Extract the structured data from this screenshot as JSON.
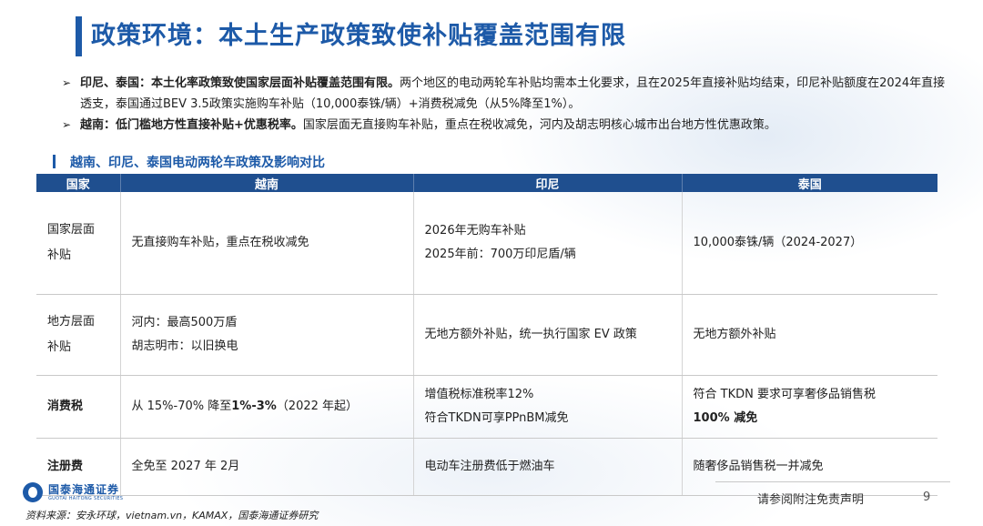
{
  "header": {
    "title": "政策环境：本土生产政策致使补贴覆盖范围有限"
  },
  "bullets": [
    {
      "arrow": "➢",
      "lead": "印尼、泰国：本土化率政策致使国家层面补贴覆盖范围有限。",
      "text": "两个地区的电动两轮车补贴均需本土化要求，且在2025年直接补贴均结束，印尼补贴额度在2024年直接透支，泰国通过BEV 3.5政策实施购车补贴（10,000泰铢/辆）+消费税减免（从5%降至1%）。"
    },
    {
      "arrow": "➢",
      "lead": "越南：低门槛地方性直接补贴+优惠税率。",
      "text": "国家层面无直接购车补贴，重点在税收减免，河内及胡志明核心城市出台地方性优惠政策。"
    }
  ],
  "section": {
    "mark": "l",
    "title": "越南、印尼、泰国电动两轮车政策及影响对比"
  },
  "table": {
    "headers": [
      "国家",
      "越南",
      "印尼",
      "泰国"
    ],
    "rows": [
      {
        "label": [
          "国家层面",
          "补贴"
        ],
        "vietnam": [
          "无直接购车补贴，重点在税收减免"
        ],
        "indonesia": [
          "2026年无购车补贴",
          "2025年前：700万印尼盾/辆"
        ],
        "thailand": [
          "10,000泰铢/辆（2024-2027）"
        ]
      },
      {
        "label": [
          "地方层面",
          "补贴"
        ],
        "vietnam": [
          "河内：最高500万盾",
          "胡志明市：以旧换电"
        ],
        "indonesia": [
          "无地方额外补贴，统一执行国家 EV 政策"
        ],
        "thailand": [
          "无地方额外补贴"
        ]
      },
      {
        "label": [
          "消费税"
        ],
        "vietnam_pre": "从 15%-70% 降至",
        "vietnam_bold": "1%-3%",
        "vietnam_post": "（2022 年起）",
        "indonesia": [
          "增值税标准税率12%",
          "符合TKDN可享PPnBM减免"
        ],
        "thailand": [
          "符合 TKDN 要求可享奢侈品销售税",
          "100% 减免"
        ]
      },
      {
        "label": [
          "注册费"
        ],
        "vietnam": [
          "全免至 2027 年 2月"
        ],
        "indonesia": [
          "电动车注册费低于燃油车"
        ],
        "thailand": [
          "随奢侈品销售税一并减免"
        ]
      }
    ]
  },
  "footer": {
    "logo_cn": "国泰海通证券",
    "logo_en": "GUOTAI HAITONG SECURITIES",
    "disclaimer": "请参阅附注免责声明",
    "page_number": "9",
    "source": "资料来源：安永环球，vietnam.vn，KAMAX，国泰海通证券研究"
  },
  "colors": {
    "brand": "#1d5aa8",
    "table_header": "#1f4f8f"
  }
}
